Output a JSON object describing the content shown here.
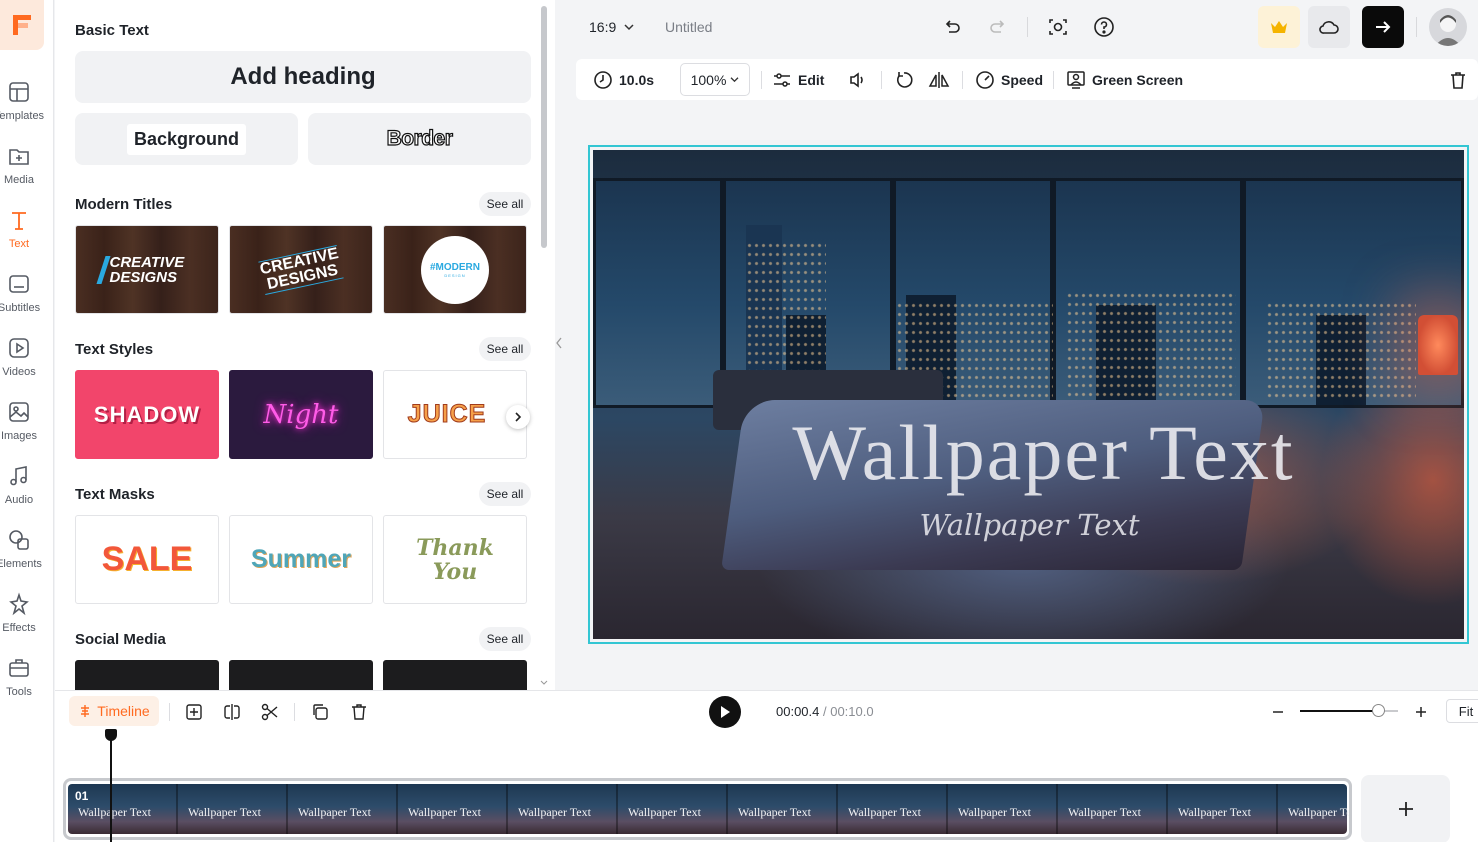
{
  "rail": {
    "items": [
      {
        "label": "Templates",
        "icon": "templates-icon"
      },
      {
        "label": "Media",
        "icon": "media-icon"
      },
      {
        "label": "Text",
        "icon": "text-icon"
      },
      {
        "label": "Subtitles",
        "icon": "subtitles-icon"
      },
      {
        "label": "Videos",
        "icon": "videos-icon"
      },
      {
        "label": "Images",
        "icon": "images-icon"
      },
      {
        "label": "Audio",
        "icon": "audio-icon"
      },
      {
        "label": "Elements",
        "icon": "elements-icon"
      },
      {
        "label": "Effects",
        "icon": "effects-icon"
      },
      {
        "label": "Tools",
        "icon": "tools-icon"
      }
    ],
    "active": "Text"
  },
  "panel": {
    "basic_title": "Basic Text",
    "add_heading": "Add heading",
    "background": "Background",
    "border": "Border",
    "see_all": "See all",
    "sections": {
      "modern_titles": {
        "title": "Modern Titles",
        "tiles": [
          "CREATIVE DESIGNS",
          "CREATIVE DESIGNS",
          "#MODERN"
        ],
        "tile_sub": "DESIGN"
      },
      "text_styles": {
        "title": "Text Styles",
        "tiles": [
          "SHADOW",
          "Night",
          "JUICE"
        ]
      },
      "text_masks": {
        "title": "Text Masks",
        "tiles": [
          "SALE",
          "Summer",
          "Thank You"
        ]
      },
      "social_media": {
        "title": "Social Media"
      }
    }
  },
  "topbar": {
    "aspect": "16:9",
    "project_name": "Untitled"
  },
  "toolbar": {
    "duration": "10.0s",
    "zoom": "100%",
    "edit": "Edit",
    "speed": "Speed",
    "green_screen": "Green Screen"
  },
  "canvas": {
    "heading": "Wallpaper Text",
    "subheading": "Wallpaper Text"
  },
  "timeline": {
    "tab": "Timeline",
    "current_time": "00:00.4",
    "separator": " / ",
    "total_time": "00:10.0",
    "fit": "Fit",
    "zoom_level": 0.8,
    "clip_number": "01",
    "clip_label": "Wallpaper Text"
  },
  "colors": {
    "accent": "#ff6a20",
    "selection": "#33c6d3",
    "crown": "#f5b400"
  }
}
